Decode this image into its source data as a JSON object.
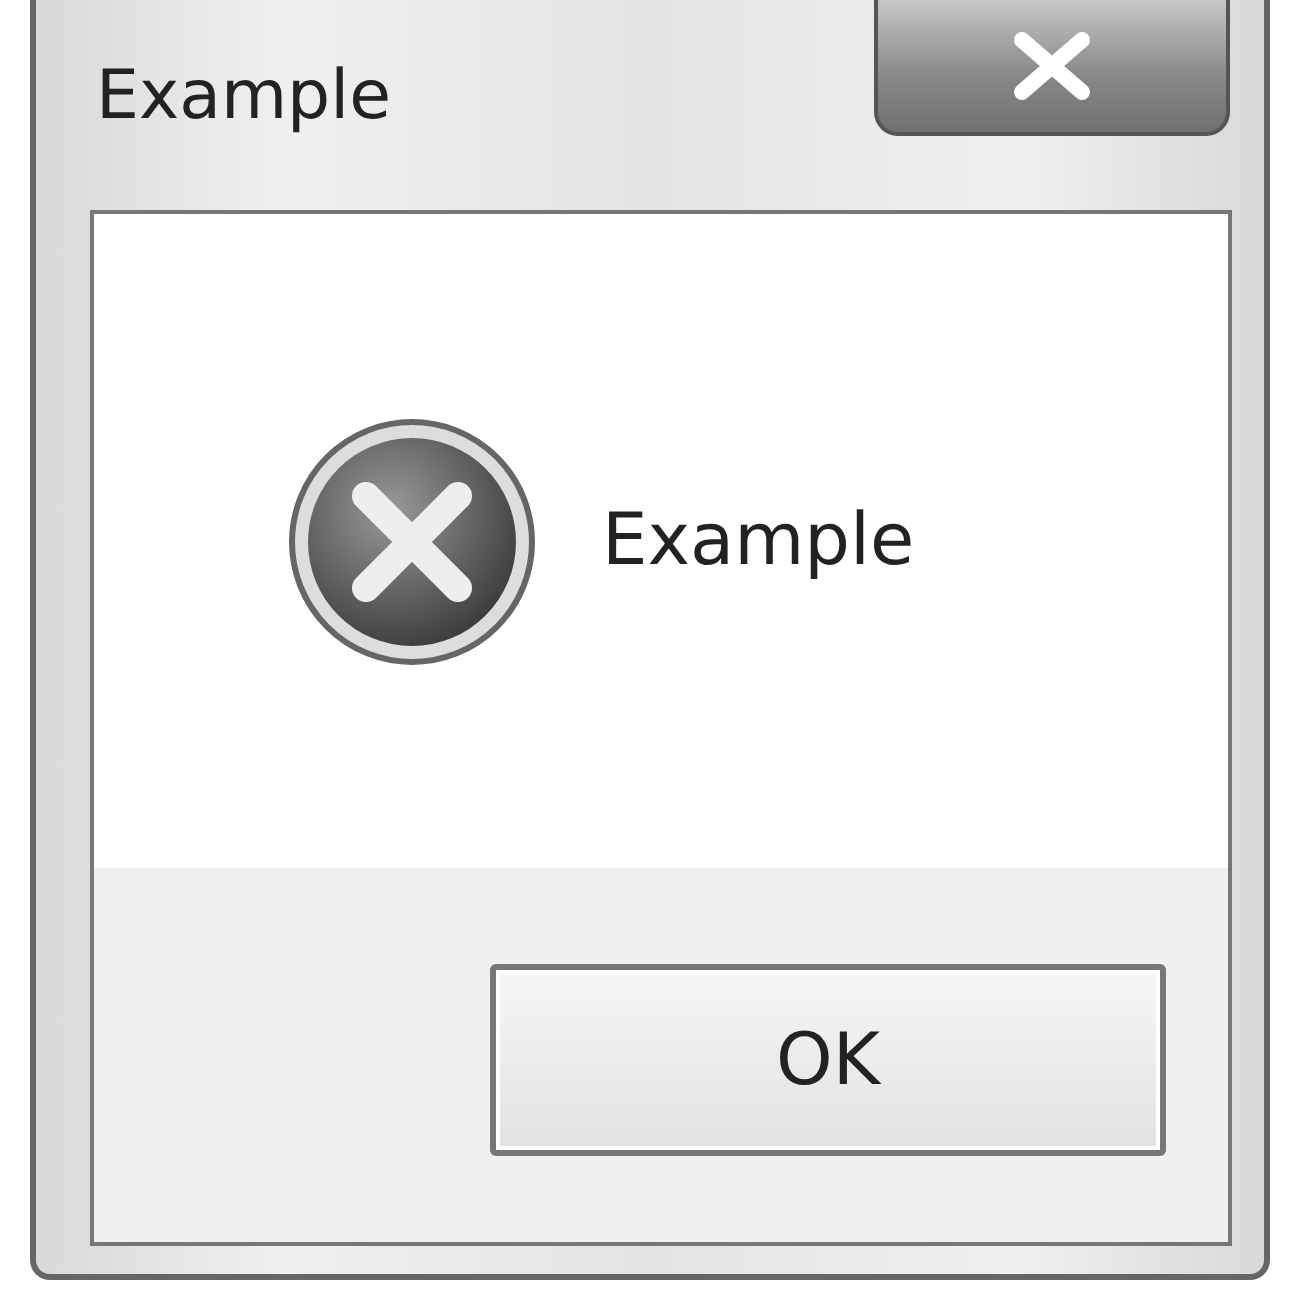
{
  "window": {
    "title": "Example"
  },
  "message": {
    "text": "Example",
    "kind": "error"
  },
  "buttons": [
    "OK"
  ]
}
